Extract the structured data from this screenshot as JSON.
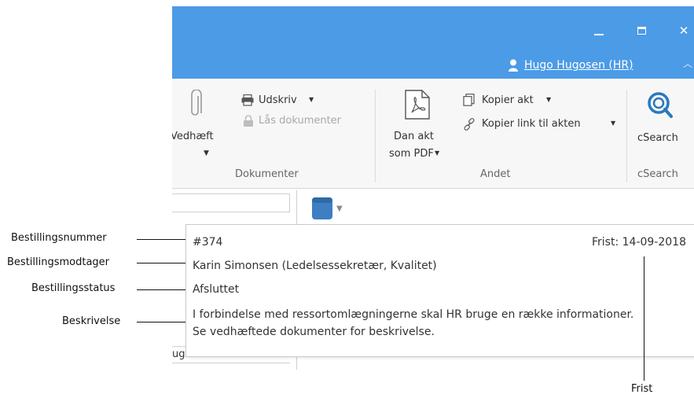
{
  "window": {
    "minimize_glyph": "‒",
    "maximize_glyph": "▢",
    "close_glyph": "✕",
    "user_name": "Hugo Hugosen (HR)"
  },
  "ribbon": {
    "vedhaeft": "Vedhæft",
    "udskriv": "Udskriv",
    "laas": "Lås dokumenter",
    "dokumenter_group": "Dokumenter",
    "dan_akt_line1": "Dan akt",
    "dan_akt_line2": "som PDF",
    "kopier_akt": "Kopier akt",
    "kopier_link": "Kopier link til akten",
    "andet_group": "Andet",
    "csearch": "cSearch",
    "csearch_group": "cSearch"
  },
  "card": {
    "number": "#374",
    "deadline": "Frist: 14-09-2018",
    "recipient": "Karin Simonsen (Ledelsessekretær, Kvalitet)",
    "status": "Afsluttet",
    "description_line1": "I forbindelse med ressortomlægningerne skal HR bruge en række informationer.",
    "description_line2": "Se vedhæftede dokumenter for beskrivelse."
  },
  "behind_text": "ug",
  "callouts": {
    "bestillingsnummer": "Bestillingsnummer",
    "bestillingsmodtager": "Bestillingsmodtager",
    "bestillingsstatus": "Bestillingsstatus",
    "beskrivelse": "Beskrivelse",
    "frist": "Frist"
  },
  "colors": {
    "titlebar": "#4c9be6",
    "ribbon_bg": "#f7f7f7",
    "book_icon": "#3d7fc2",
    "csearch_icon": "#2a78c0"
  }
}
